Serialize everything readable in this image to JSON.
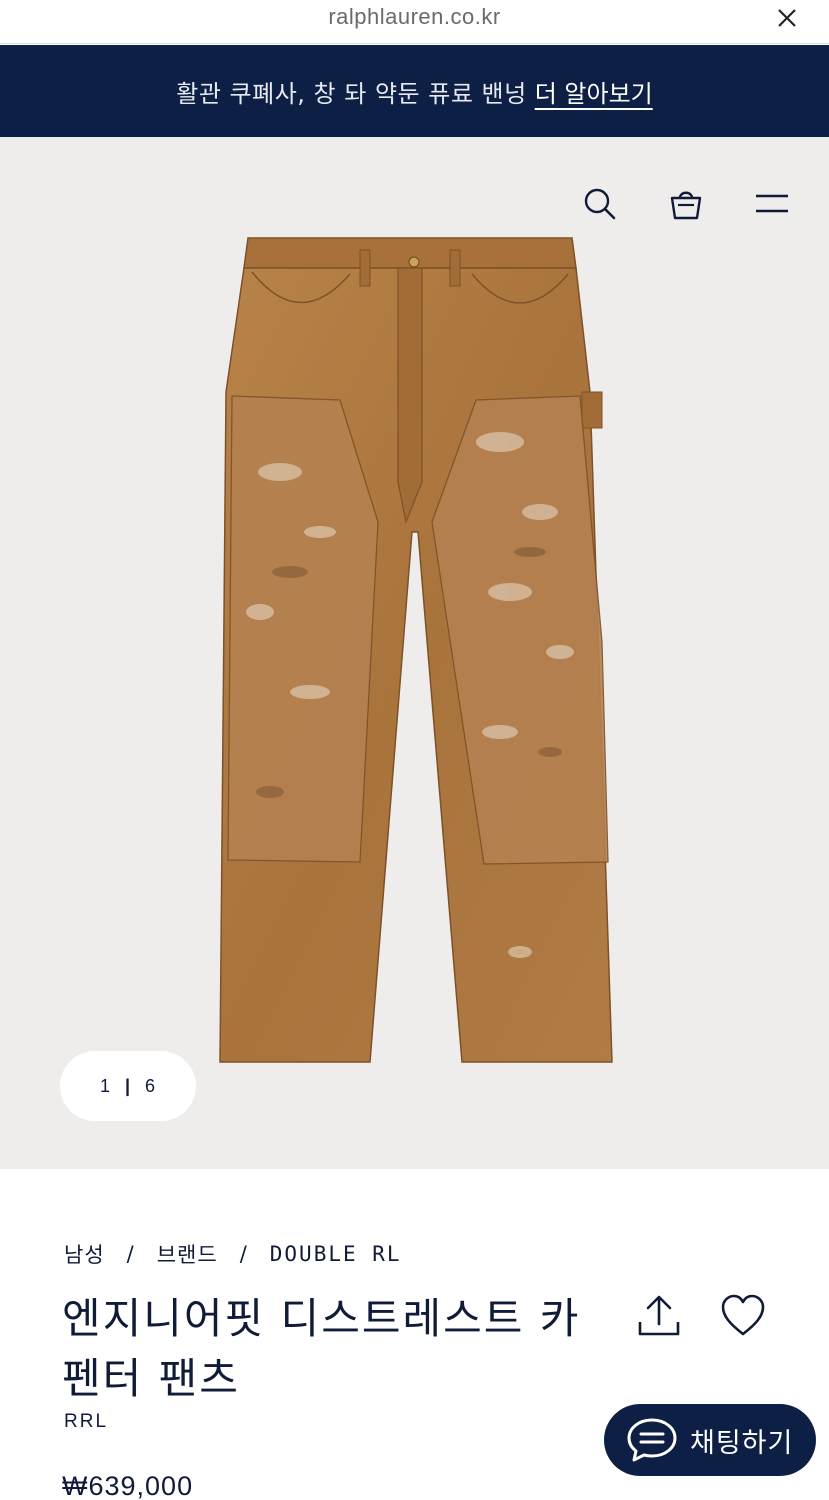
{
  "browser": {
    "url": "ralphlauren.co.kr",
    "close_icon": "close-icon"
  },
  "promo": {
    "text": "활관 쿠폐사, 창 돠 약둔 퓨료 밴넝",
    "link": "더 알아보기"
  },
  "header": {
    "icons": [
      "search-icon",
      "shopping-bag-icon",
      "menu-icon"
    ]
  },
  "gallery": {
    "current": "1",
    "separator": "|",
    "total": "6",
    "background": "#efedec",
    "product_color": "#b07b45"
  },
  "product": {
    "breadcrumb": [
      "남성",
      "브랜드",
      "DOUBLE RL"
    ],
    "breadcrumb_separator": "/",
    "title": "엔지니어핏 디스트레스트 카펜터 팬츠",
    "brand": "RRL",
    "price": "₩639,000"
  },
  "chat": {
    "label": "채팅하기",
    "icon": "chat-bubble-icon"
  },
  "colors": {
    "navy": "#0d1f44",
    "text": "#0f1b38"
  }
}
